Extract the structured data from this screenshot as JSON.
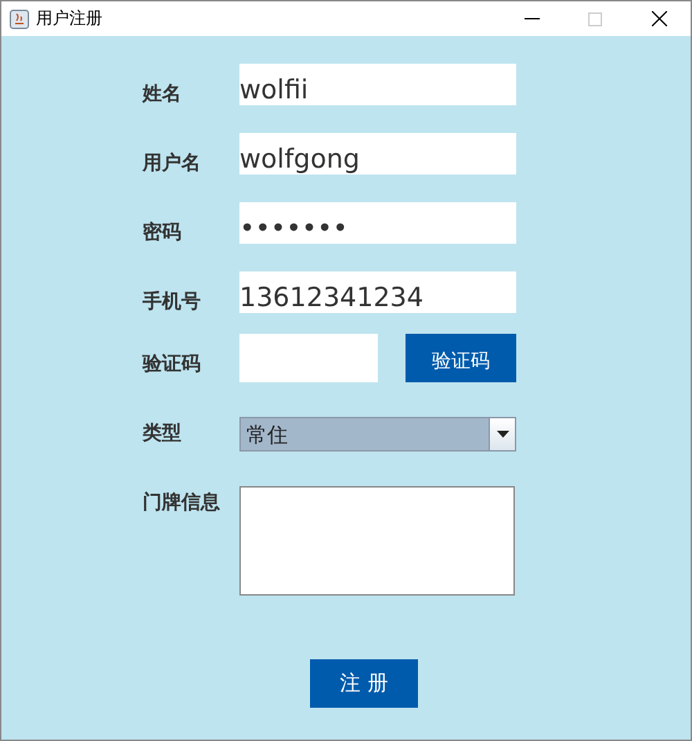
{
  "window": {
    "title": "用户注册",
    "maximize_disabled": true
  },
  "fields": [
    {
      "kind": "text",
      "label": "姓名",
      "value": "wolfii"
    },
    {
      "kind": "text",
      "label": "用户名",
      "value": "wolfgong"
    },
    {
      "kind": "text",
      "label": "密码",
      "value": "•••••••"
    },
    {
      "kind": "text",
      "label": "手机号",
      "value": "13612341234"
    },
    {
      "kind": "code",
      "label": "验证码",
      "button": "验证码"
    },
    {
      "kind": "select",
      "label": "类型",
      "value": "常住"
    },
    {
      "kind": "textarea",
      "label": "门牌信息"
    }
  ],
  "submit": "注 册"
}
